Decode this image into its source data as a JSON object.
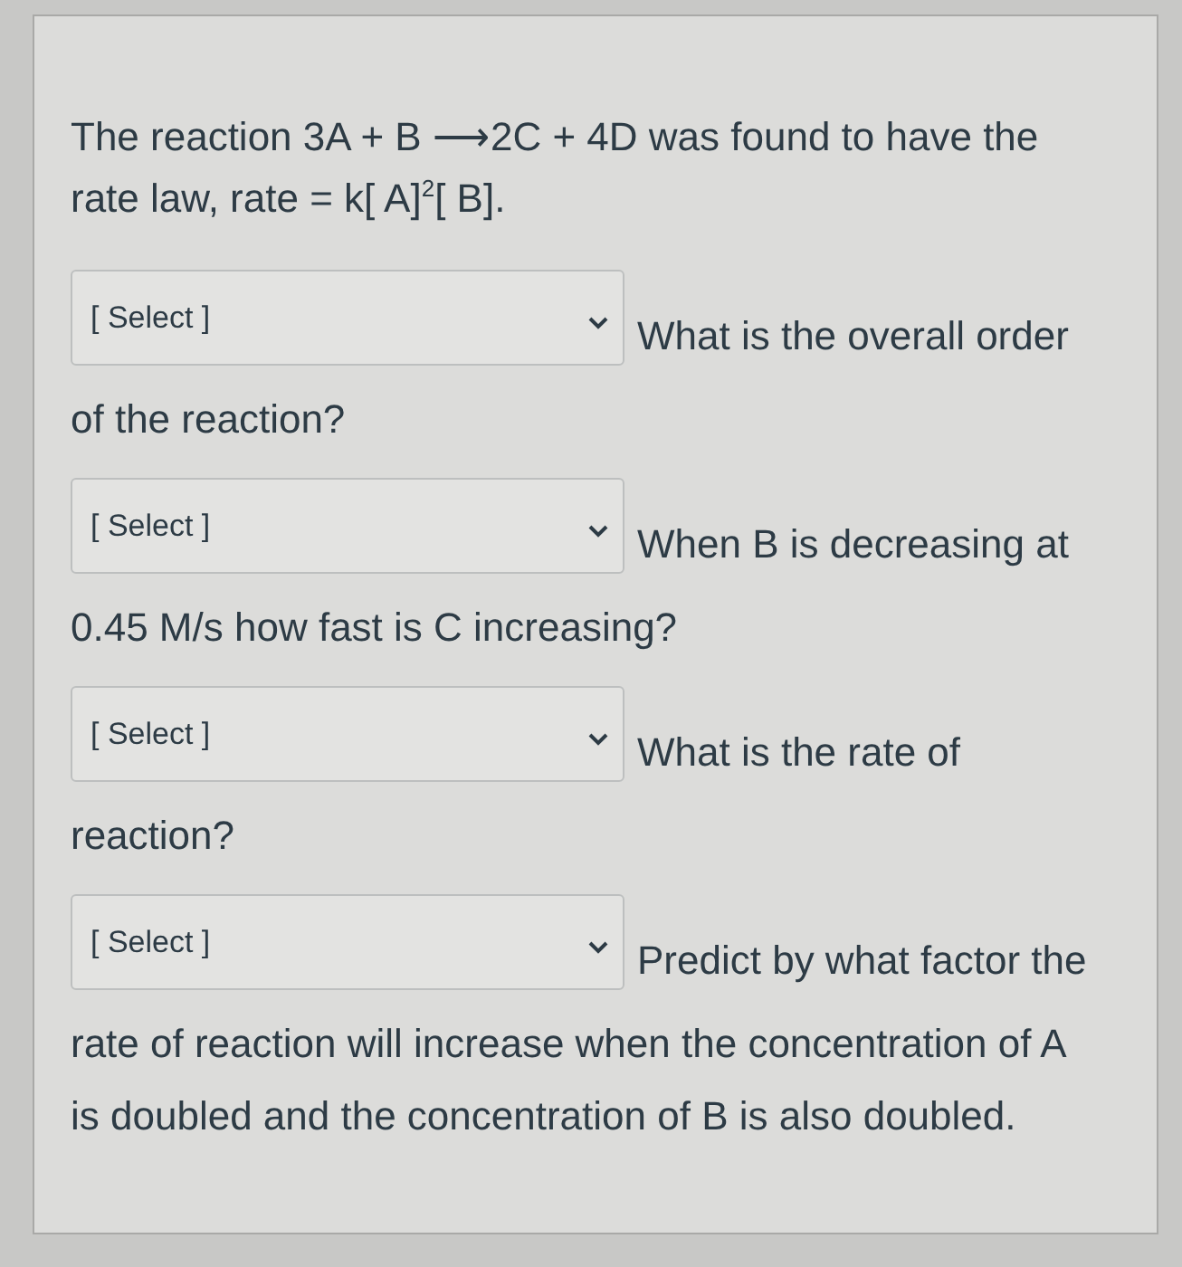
{
  "question": {
    "intro": "The reaction 3A + B ⟶2C + 4D was found to have the rate law, rate = k[ A]$^{2}$[ B].",
    "blanks": [
      {
        "placeholder": "[ Select ]",
        "text_beside": "What is the overall order",
        "text_below": "of the reaction?"
      },
      {
        "placeholder": "[ Select ]",
        "text_beside": "When B is decreasing at",
        "text_below": "0.45 M/s how fast is C increasing?"
      },
      {
        "placeholder": "[ Select ]",
        "text_beside": "What is the rate of",
        "text_below": "reaction?"
      },
      {
        "placeholder": "[ Select ]",
        "text_beside": "Predict by what factor the",
        "text_below": "rate of reaction will increase when the concentration of A is doubled and the concentration of B is also doubled."
      }
    ]
  }
}
